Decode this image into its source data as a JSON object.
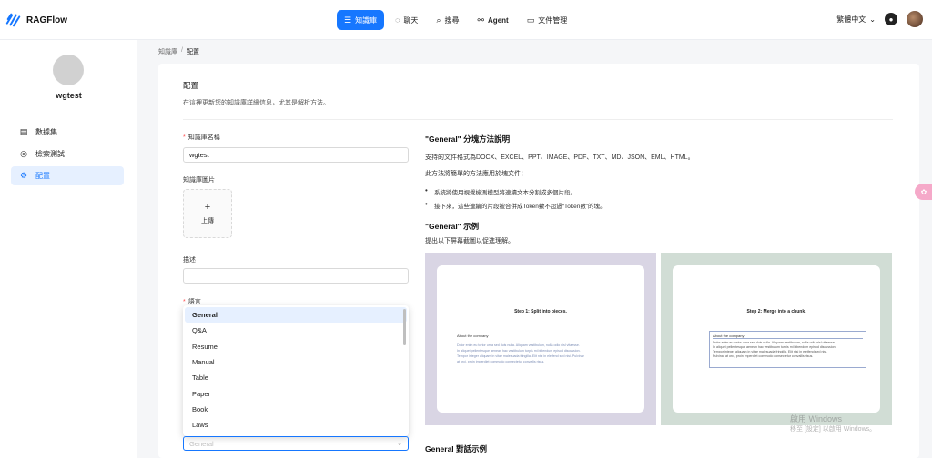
{
  "app": {
    "name": "RAGFlow"
  },
  "nav": {
    "items": [
      {
        "icon": "database-icon",
        "label": "知識庫",
        "active": true
      },
      {
        "icon": "chat-icon",
        "label": "聊天",
        "active": false
      },
      {
        "icon": "search-icon",
        "label": "搜尋",
        "active": false
      },
      {
        "icon": "agent-icon",
        "label": "Agent",
        "active": false
      },
      {
        "icon": "folder-icon",
        "label": "文件管理",
        "active": false
      }
    ],
    "language": "繁體中文"
  },
  "sidebar": {
    "kb_name": "wgtest",
    "items": [
      {
        "icon": "dataset-icon",
        "label": "數據集",
        "active": false
      },
      {
        "icon": "retrieval-test-icon",
        "label": "檢索測試",
        "active": false
      },
      {
        "icon": "settings-icon",
        "label": "配置",
        "active": true
      }
    ]
  },
  "breadcrumb": {
    "parent": "知識庫",
    "separator": "/",
    "current": "配置"
  },
  "form": {
    "title": "配置",
    "subtitle": "在這裡更新您的知識庫詳細信息，尤其是解析方法。",
    "name_label": "知識庫名稱",
    "name_value": "wgtest",
    "image_label": "知識庫圖片",
    "upload_label": "上傳",
    "desc_label": "描述",
    "desc_value": "",
    "lang_label": "語言",
    "parser_options": [
      "General",
      "Q&A",
      "Resume",
      "Manual",
      "Table",
      "Paper",
      "Book",
      "Laws"
    ],
    "parser_selected": "General",
    "select_placeholder": "General"
  },
  "guide": {
    "method_title": "\"General\" 分塊方法說明",
    "formats": "支持的文件格式為DOCX、EXCEL、PPT、IMAGE、PDF、TXT、MD、JSON、EML、HTML。",
    "intro": "此方法將簡單的方法應用於塊文件：",
    "bullets": [
      "系統將使用視覺檢測模型將連續文本分割成多個片段。",
      "接下來，這些連續的片段被合併成Token數不超過“Token數”的塊。"
    ],
    "example_title": "\"General\" 示例",
    "example_sub": "提出以下屏幕截圖以促進理解。",
    "dialog_title": "General 對話示例",
    "step1": "Step 1: Split into pieces.",
    "step2": "Step 2: Merge into a chunk.",
    "about": "About the company",
    "chunk_lines": [
      "Dolor enim eu tortor urna sed duis nulla. Aliquam vestibulum, nulla odio nisl vitaesse.",
      "In aliquet pellentesque aenean hac vestibulum turpis mi bibendum episod discussion.",
      "Tempor integer aliquam in vitae malesuada fringilla. Elit nisi in eleifend sed nisi. Pulvinar",
      "at orci, proin imperdiet commodo consectetur convallis risus."
    ],
    "merged_lines": [
      "Dolor enim eu tortor urna sed duis nulla. Aliquam vestibulum, nulla odio nisl vitaesse.",
      "In aliquet pellentesque aenean hac vestibulum turpis mi bibendum episod discussion.",
      "Tempor integer aliquam in vitae malesuada fringilla. Elit nisi in eleifend sed nisi.",
      "Pulvinar at orci, proin imperdiet commodo consectetur convallis risus."
    ]
  },
  "watermark": {
    "line1": "啟用 Windows",
    "line2": "移至 [設定] 以啟用 Windows。"
  },
  "colors": {
    "accent": "#1677ff",
    "example_bg_1": "#d9d5e4",
    "example_bg_2": "#d1ddd5"
  }
}
